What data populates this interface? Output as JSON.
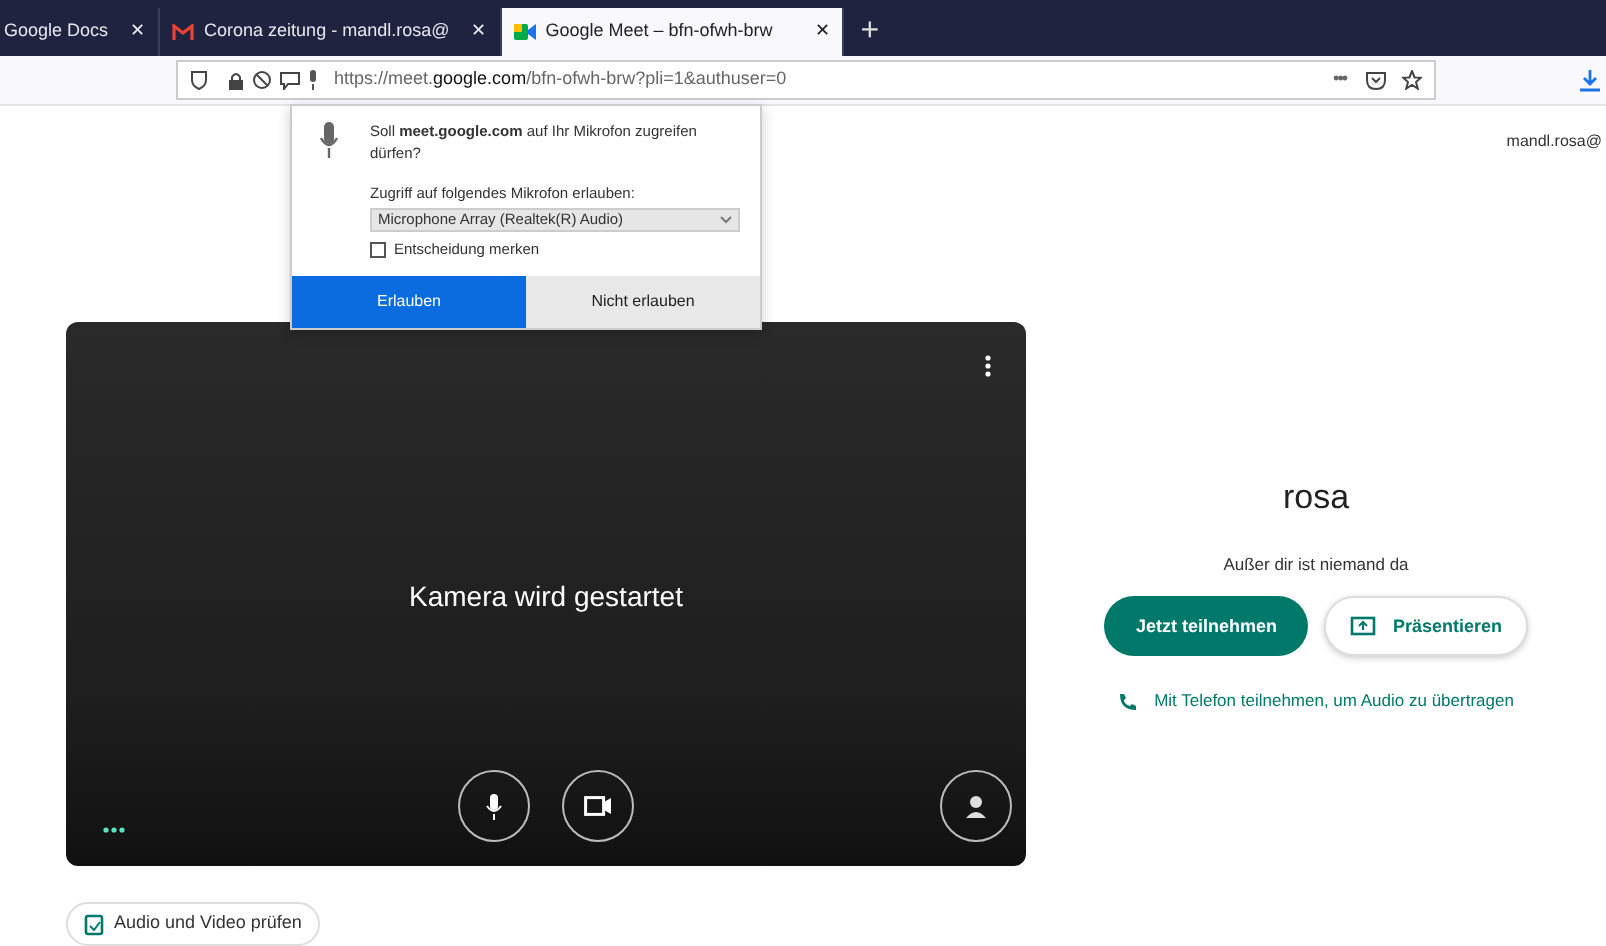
{
  "tabs": [
    {
      "label": "Google Docs",
      "kind": "plain",
      "selected": false,
      "close": "✕"
    },
    {
      "label": "Corona zeitung - mandl.rosa@",
      "kind": "mail",
      "selected": false,
      "close": "✕"
    },
    {
      "label": "Google Meet – bfn-ofwh-brw",
      "kind": "video",
      "selected": true,
      "close": "✕"
    }
  ],
  "new_tab": "+",
  "address_bar": {
    "url": "https://meet.**google.com**/bfn-ofwh-brw?pli=1&authuser=0",
    "menu": "•••"
  },
  "permission_popup": {
    "question": "Soll **meet.google.com** auf Ihr Mikrofon zugreifen dürfen?",
    "device_label": "Zugriff auf folgendes Mikrofon erlauben:",
    "device": "Microphone Array (Realtek(R) Audio)",
    "remember": {
      "label": "Entscheidung merken",
      "checked": false
    },
    "buttons": [
      {
        "label": "Erlauben",
        "selected": true
      },
      {
        "label": "Nicht erlauben",
        "selected": false
      }
    ]
  },
  "account": "mandl.rosa@",
  "video_tile": {
    "status": "Kamera wird gestartet",
    "controls": [
      {
        "kind": "mic"
      },
      {
        "kind": "camera"
      }
    ]
  },
  "join_panel": {
    "name": "rosa",
    "info": "Außer dir ist niemand da",
    "join_button": "Jetzt teilnehmen",
    "present_button": "Präsentieren",
    "phone_link": "Mit Telefon teilnehmen, um Audio zu übertragen"
  },
  "check_button": "Audio und Video prüfen"
}
